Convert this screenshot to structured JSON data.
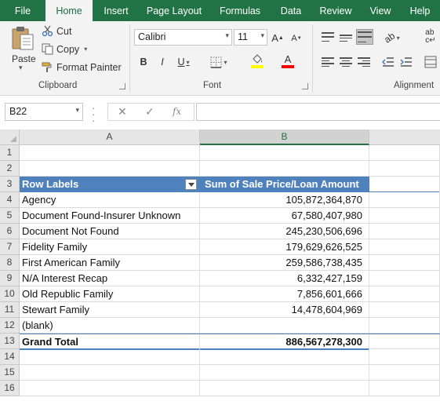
{
  "tabs": [
    "File",
    "Home",
    "Insert",
    "Page Layout",
    "Formulas",
    "Data",
    "Review",
    "View",
    "Help"
  ],
  "active_tab": "Home",
  "clipboard": {
    "paste_label": "Paste",
    "cut_label": "Cut",
    "copy_label": "Copy",
    "format_painter_label": "Format Painter",
    "group_label": "Clipboard"
  },
  "font": {
    "font_name": "Calibri",
    "font_size": "11",
    "bold": "B",
    "italic": "I",
    "underline": "U",
    "grow": "A",
    "shrink": "A",
    "font_color_letter": "A",
    "group_label": "Font"
  },
  "alignment": {
    "group_label": "Alignment"
  },
  "colors": {
    "accent": "#217346",
    "pivot_header": "#4f81bd",
    "highlight": "#ffff00",
    "font_color": "#ff0000"
  },
  "formula_bar": {
    "name_box": "B22",
    "fx": "fx",
    "formula": ""
  },
  "columns": [
    "A",
    "B"
  ],
  "selected_column": "B",
  "rows": [
    {
      "num": "1",
      "a": "",
      "b": ""
    },
    {
      "num": "2",
      "a": "",
      "b": ""
    },
    {
      "num": "3",
      "a": "Row Labels",
      "b": "Sum of Sale Price/Loan Amount"
    },
    {
      "num": "4",
      "a": "Agency",
      "b": "105,872,364,870"
    },
    {
      "num": "5",
      "a": "Document Found-Insurer Unknown",
      "b": "67,580,407,980"
    },
    {
      "num": "6",
      "a": "Document Not Found",
      "b": "245,230,506,696"
    },
    {
      "num": "7",
      "a": "Fidelity Family",
      "b": "179,629,626,525"
    },
    {
      "num": "8",
      "a": "First American Family",
      "b": "259,586,738,435"
    },
    {
      "num": "9",
      "a": "N/A Interest Recap",
      "b": "6,332,427,159"
    },
    {
      "num": "10",
      "a": "Old Republic Family",
      "b": "7,856,601,666"
    },
    {
      "num": "11",
      "a": "Stewart Family",
      "b": "14,478,604,969"
    },
    {
      "num": "12",
      "a": "(blank)",
      "b": ""
    },
    {
      "num": "13",
      "a": "Grand Total",
      "b": "886,567,278,300"
    },
    {
      "num": "14",
      "a": "",
      "b": ""
    },
    {
      "num": "15",
      "a": "",
      "b": ""
    },
    {
      "num": "16",
      "a": "",
      "b": ""
    }
  ]
}
